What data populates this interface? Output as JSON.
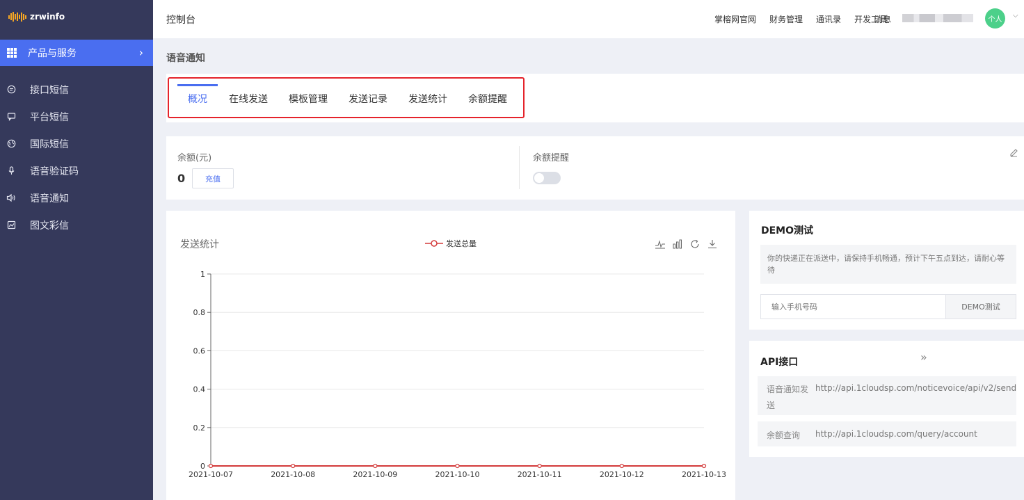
{
  "app": {
    "logo_text": "zrwinfo"
  },
  "sidebar": {
    "group_label": "产品与服务",
    "items": [
      {
        "label": "接口短信",
        "icon": "chat-icon"
      },
      {
        "label": "平台短信",
        "icon": "message-icon"
      },
      {
        "label": "国际短信",
        "icon": "globe-icon"
      },
      {
        "label": "语音验证码",
        "icon": "microphone-icon"
      },
      {
        "label": "语音通知",
        "icon": "speaker-icon"
      },
      {
        "label": "图文彩信",
        "icon": "image-icon"
      }
    ]
  },
  "header": {
    "title": "控制台",
    "nav": [
      "掌榕网官网",
      "财务管理",
      "通讯录",
      "开发工具"
    ],
    "messages": "消息",
    "avatar_text": "个人"
  },
  "page": {
    "title": "语音通知"
  },
  "tabs": [
    {
      "label": "概况",
      "active": true
    },
    {
      "label": "在线发送"
    },
    {
      "label": "模板管理"
    },
    {
      "label": "发送记录"
    },
    {
      "label": "发送统计"
    },
    {
      "label": "余额提醒"
    }
  ],
  "balance": {
    "label": "余额(元)",
    "value": "0",
    "recharge_label": "充值",
    "remind_label": "余额提醒",
    "remind_enabled": false
  },
  "chart_data": {
    "type": "line",
    "title": "发送统计",
    "series": [
      {
        "name": "发送总量",
        "color": "#d33a3a",
        "values": [
          0,
          0,
          0,
          0,
          0,
          0,
          0
        ]
      }
    ],
    "x": [
      "2021-10-07",
      "2021-10-08",
      "2021-10-09",
      "2021-10-10",
      "2021-10-11",
      "2021-10-12",
      "2021-10-13"
    ],
    "yticks": [
      "0",
      "0.2",
      "0.4",
      "0.6",
      "0.8",
      "1"
    ],
    "ylim": [
      0,
      1
    ],
    "grid": true,
    "legend": "top-center",
    "tools": [
      "line-chart-icon",
      "bar-chart-icon",
      "refresh-icon",
      "download-icon"
    ]
  },
  "demo": {
    "title": "DEMO测试",
    "message": "你的快递正在派送中，请保持手机畅通，预计下午五点到达，请耐心等待",
    "phone_placeholder": "输入手机号码",
    "button_label": "DEMO测试"
  },
  "api": {
    "title": "API接口",
    "rows": [
      {
        "label_line1": "语音通知发",
        "label_line2": "送",
        "url": "http://api.1cloudsp.com/noticevoice/api/v2/send"
      },
      {
        "label": "余额查询",
        "url": "http://api.1cloudsp.com/query/account"
      }
    ]
  }
}
